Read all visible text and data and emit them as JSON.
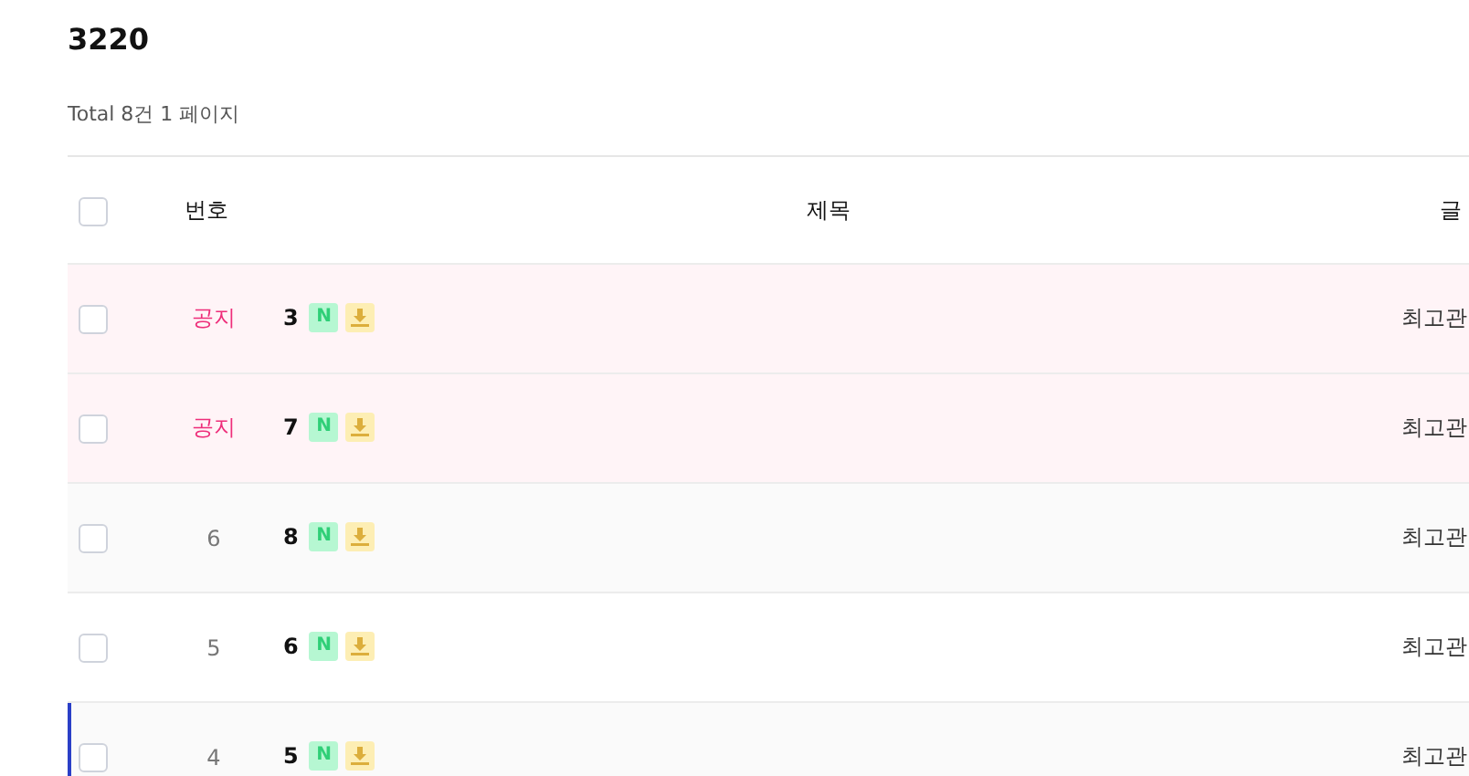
{
  "title": "3220",
  "summary": "Total 8건 1 페이지",
  "table": {
    "columns": [
      {
        "label": "번호"
      },
      {
        "label": "제목"
      },
      {
        "label": "글"
      }
    ],
    "header_checked": false,
    "rows": [
      {
        "kind": "notice",
        "number": "공지",
        "title": "3",
        "new_badge": "N",
        "file": true,
        "author": "최고관",
        "checked": false,
        "selected": false
      },
      {
        "kind": "notice",
        "number": "공지",
        "title": "7",
        "new_badge": "N",
        "file": true,
        "author": "최고관",
        "checked": false,
        "selected": false
      },
      {
        "kind": "post",
        "number": "6",
        "title": "8",
        "new_badge": "N",
        "file": true,
        "author": "최고관",
        "checked": false,
        "selected": false
      },
      {
        "kind": "post",
        "number": "5",
        "title": "6",
        "new_badge": "N",
        "file": true,
        "author": "최고관",
        "checked": false,
        "selected": false
      },
      {
        "kind": "post",
        "number": "4",
        "title": "5",
        "new_badge": "N",
        "file": true,
        "author": "최고관",
        "checked": false,
        "selected": true
      }
    ]
  }
}
